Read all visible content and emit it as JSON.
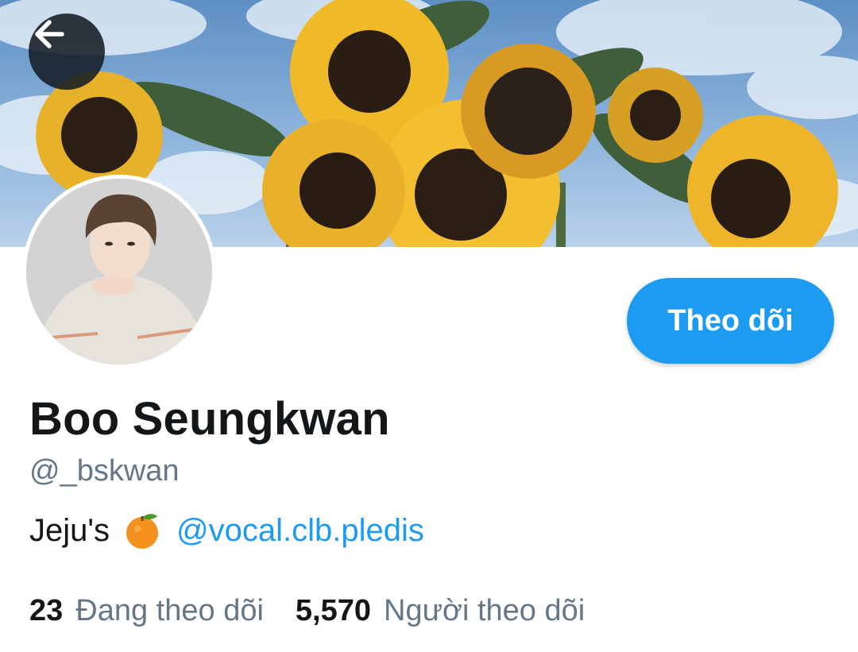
{
  "header": {
    "banner_image": "sunflowers-banner",
    "back_icon": "arrow-left-icon"
  },
  "profile": {
    "avatar": "profile-photo",
    "display_name": "Boo Seungkwan",
    "handle": "@_bskwan",
    "follow_label": "Theo dõi",
    "bio": {
      "text": "Jeju's",
      "emoji_icon": "tangerine-icon",
      "mention": "@vocal.clb.pledis"
    },
    "stats": {
      "following_count": "23",
      "following_label": "Đang theo dõi",
      "followers_count": "5,570",
      "followers_label": "Người theo dõi"
    }
  },
  "colors": {
    "accent": "#1d9bf0",
    "text_primary": "#14171a",
    "text_secondary": "#657786"
  }
}
